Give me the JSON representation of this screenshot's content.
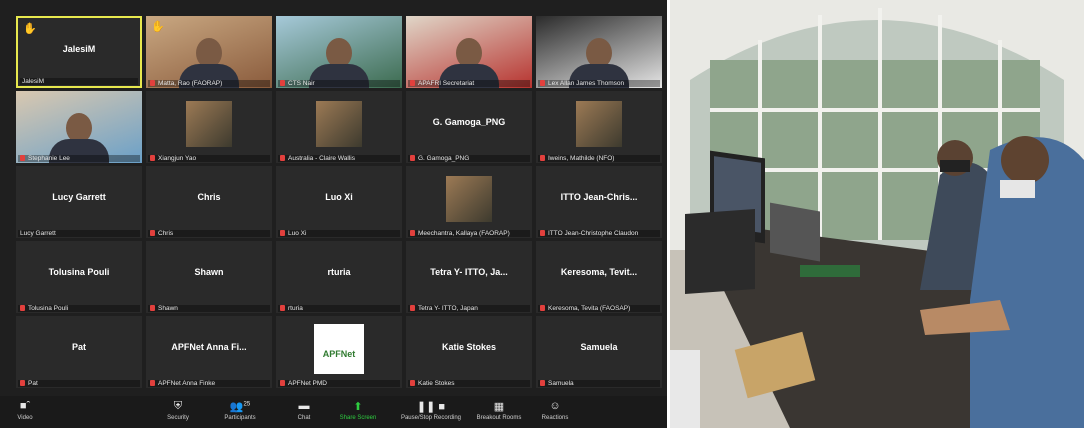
{
  "participants": [
    {
      "name": "JalesiM",
      "label": "JalesiM",
      "hand": true,
      "video": false,
      "active": true,
      "mic": false
    },
    {
      "name": "",
      "label": "Matta, Rao (FAORAP)",
      "hand": true,
      "video": true,
      "mic": true
    },
    {
      "name": "",
      "label": "CTS Nair",
      "video": true,
      "mic": true
    },
    {
      "name": "",
      "label": "APAFRI Secretariat",
      "video": true,
      "mic": true
    },
    {
      "name": "",
      "label": "Lex Allan James Thomson",
      "video": true,
      "mic": true
    },
    {
      "name": "",
      "label": "Stephanie Lee",
      "video": true,
      "mic": true
    },
    {
      "name": "",
      "label": "Xiangjun Yao",
      "video": false,
      "pic": true,
      "mic": true
    },
    {
      "name": "",
      "label": "Australia - Claire Wallis",
      "video": false,
      "pic": true,
      "mic": true
    },
    {
      "name": "G. Gamoga_PNG",
      "label": "G. Gamoga_PNG",
      "video": false,
      "mic": true
    },
    {
      "name": "",
      "label": "Iweins, Mathilde (NFO)",
      "video": false,
      "pic": true,
      "mic": true
    },
    {
      "name": "Lucy Garrett",
      "label": "Lucy Garrett",
      "video": false,
      "mic": false
    },
    {
      "name": "Chris",
      "label": "Chris",
      "video": false,
      "mic": true
    },
    {
      "name": "Luo Xi",
      "label": "Luo Xi",
      "video": false,
      "mic": true
    },
    {
      "name": "",
      "label": "Meechantra, Kallaya (FAORAP)",
      "video": false,
      "pic": true,
      "mic": true
    },
    {
      "name": "ITTO  Jean-Chris...",
      "label": "ITTO Jean-Christophe Claudon",
      "video": false,
      "mic": true
    },
    {
      "name": "Tolusina Pouli",
      "label": "Tolusina Pouli",
      "video": false,
      "mic": true
    },
    {
      "name": "Shawn",
      "label": "Shawn",
      "video": false,
      "mic": true
    },
    {
      "name": "rturia",
      "label": "rturia",
      "video": false,
      "mic": true
    },
    {
      "name": "Tetra Y- ITTO, Ja...",
      "label": "Tetra Y- ITTO, Japan",
      "video": false,
      "mic": true
    },
    {
      "name": "Keresoma, Tevit...",
      "label": "Keresoma, Tevita (FAOSAP)",
      "video": false,
      "mic": true
    },
    {
      "name": "Pat",
      "label": "Pat",
      "video": false,
      "mic": true
    },
    {
      "name": "APFNet  Anna Fi...",
      "label": "APFNet Anna Finke",
      "video": false,
      "mic": true
    },
    {
      "name": "",
      "label": "APFNet PMD",
      "video": false,
      "logo": "APFNet",
      "mic": true
    },
    {
      "name": "Katie Stokes",
      "label": "Katie Stokes",
      "video": false,
      "mic": true
    },
    {
      "name": "Samuela",
      "label": "Samuela",
      "video": false,
      "mic": true
    }
  ],
  "toolbar": [
    {
      "icon": "video-icon",
      "label": "Video"
    },
    {
      "icon": "shield-icon",
      "label": "Security"
    },
    {
      "icon": "participants-icon",
      "label": "Participants",
      "count": "25"
    },
    {
      "icon": "chat-icon",
      "label": "Chat"
    },
    {
      "icon": "share-screen-icon",
      "label": "Share Screen"
    },
    {
      "icon": "record-icon",
      "label": "Pause/Stop Recording"
    },
    {
      "icon": "breakout-icon",
      "label": "Breakout Rooms"
    },
    {
      "icon": "reactions-icon",
      "label": "Reactions"
    }
  ],
  "colors": {
    "active_border": "#e7e84e",
    "mic_muted": "#e2403d",
    "share_green": "#2ecc40",
    "bg": "#1f1f1f",
    "tile": "#2a2a2a"
  }
}
